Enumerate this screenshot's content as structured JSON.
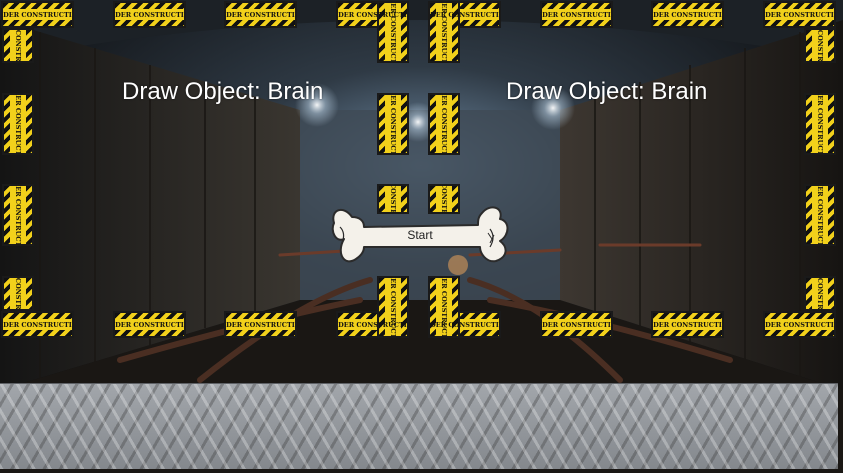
{
  "hud": {
    "left_label": "Draw Object: Brain",
    "right_label": "Draw Object: Brain"
  },
  "start_button": {
    "label": "Start",
    "shape": "bone"
  },
  "signs": {
    "text": "UNDER CONSTRUCTION",
    "color": "#f2d11b"
  },
  "floor": {
    "texture": "diamond-plate-metal",
    "color": "#8e9297"
  }
}
